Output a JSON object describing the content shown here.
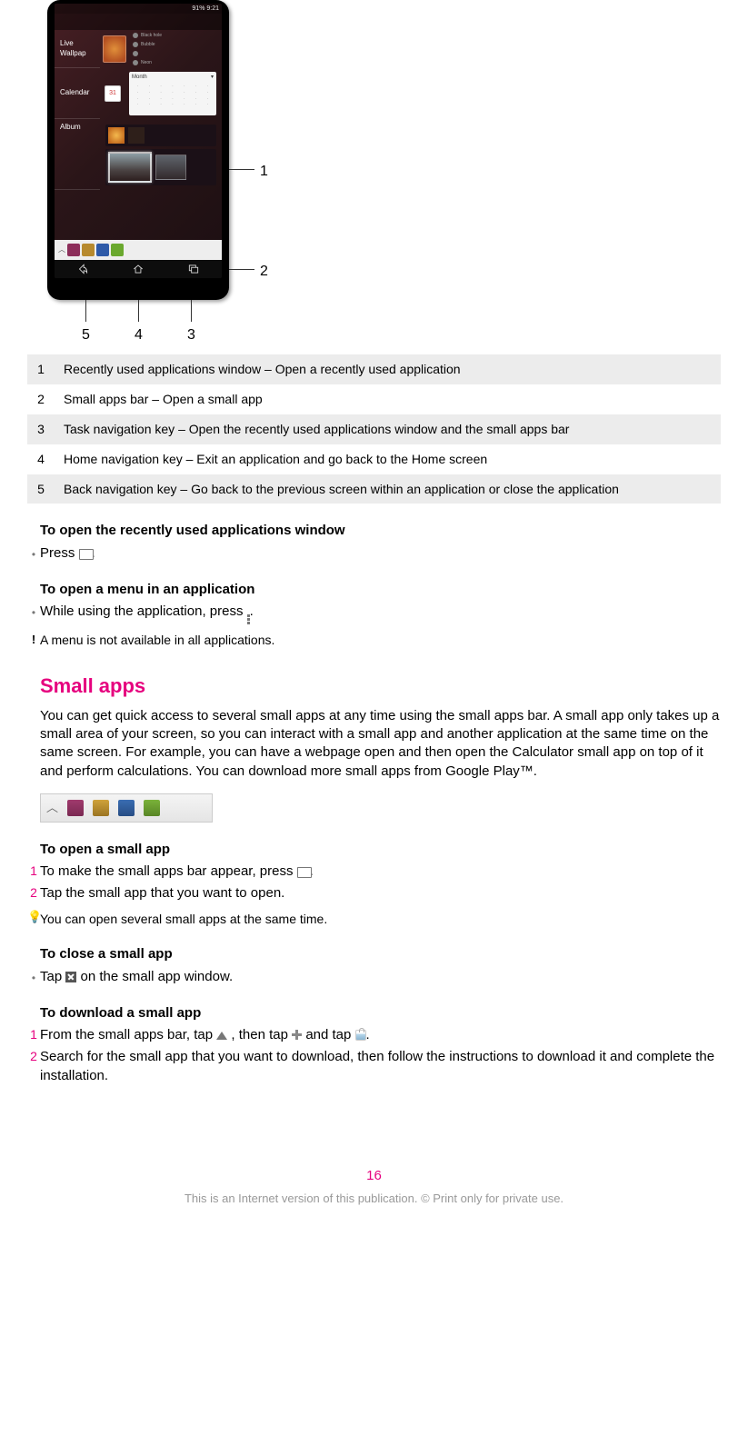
{
  "phone": {
    "status_right": "91%  9:21",
    "rows": {
      "wallpaper": "Live Wallpap",
      "calendar": "Calendar",
      "album": "Album"
    },
    "cal_icon": "31",
    "cal_month": "Month",
    "wp_items": [
      "Black hole",
      "Bubble",
      "",
      "Neon"
    ]
  },
  "legend": {
    "r1n": "1",
    "r1t": "Recently used applications window – Open a recently used application",
    "r2n": "2",
    "r2t": "Small apps bar – Open a small app",
    "r3n": "3",
    "r3t": "Task navigation key – Open the recently used applications window and the small apps bar",
    "r4n": "4",
    "r4t": "Home navigation key – Exit an application and go back to the Home screen",
    "r5n": "5",
    "r5t": "Back navigation key – Go back to the previous screen within an application or close the application"
  },
  "callouts": {
    "c1": "1",
    "c2": "2",
    "c3": "3",
    "c4": "4",
    "c5": "5"
  },
  "sec1": {
    "h": "To open the recently used applications window",
    "b": "•",
    "t1": "Press ",
    "t2": "."
  },
  "sec2": {
    "h": "To open a menu in an application",
    "b": "•",
    "t1": "While using the application, press ",
    "t2": ".",
    "note": "A menu is not available in all applications."
  },
  "small_apps": {
    "h": "Small apps",
    "p": "You can get quick access to several small apps at any time using the small apps bar. A small app only takes up a small area of your screen, so you can interact with a small app and another application at the same time on the same screen. For example, you can have a webpage open and then open the Calculator small app on top of it and perform calculations. You can download more small apps from Google Play™."
  },
  "open_sa": {
    "h": "To open a small app",
    "n1": "1",
    "t1a": "To make the small apps bar appear, press ",
    "t1b": ".",
    "n2": "2",
    "t2": "Tap the small app that you want to open.",
    "tip": "You can open several small apps at the same time."
  },
  "close_sa": {
    "h": "To close a small app",
    "b": "•",
    "t1": "Tap ",
    "t2": " on the small app window."
  },
  "dl_sa": {
    "h": "To download a small app",
    "n1": "1",
    "t1a": "From the small apps bar, tap  ",
    "t1b": " , then tap ",
    "t1c": " and tap ",
    "t1d": ".",
    "n2": "2",
    "t2": "Search for the small app that you want to download, then follow the instructions to download it and complete the installation."
  },
  "page": "16",
  "footer": "This is an Internet version of this publication. © Print only for private use."
}
